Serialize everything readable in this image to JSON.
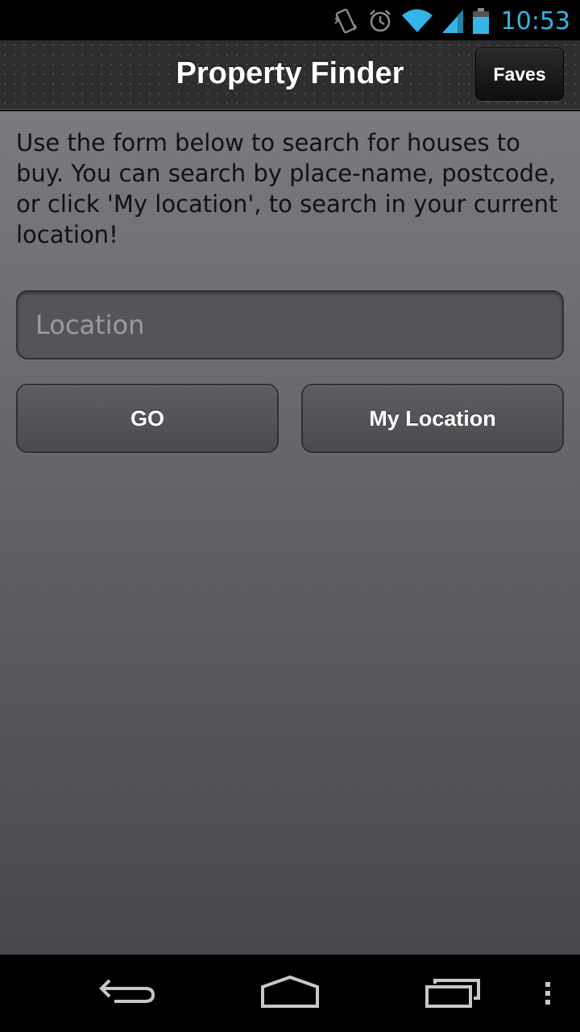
{
  "status_bar": {
    "time": "10:53",
    "icons": [
      "vibrate-icon",
      "alarm-icon",
      "wifi-icon",
      "signal-icon",
      "battery-icon"
    ],
    "accent_color": "#33b5e5"
  },
  "header": {
    "title": "Property Finder",
    "faves_label": "Faves"
  },
  "main": {
    "intro_text": "Use the form below to search for houses to buy. You can search by place-name, postcode, or click 'My location', to search in your current location!",
    "location_input": {
      "placeholder": "Location",
      "value": ""
    },
    "go_label": "GO",
    "my_location_label": "My Location"
  },
  "nav_bar": {
    "icons": [
      "back-icon",
      "home-icon",
      "recent-apps-icon",
      "menu-icon"
    ]
  }
}
